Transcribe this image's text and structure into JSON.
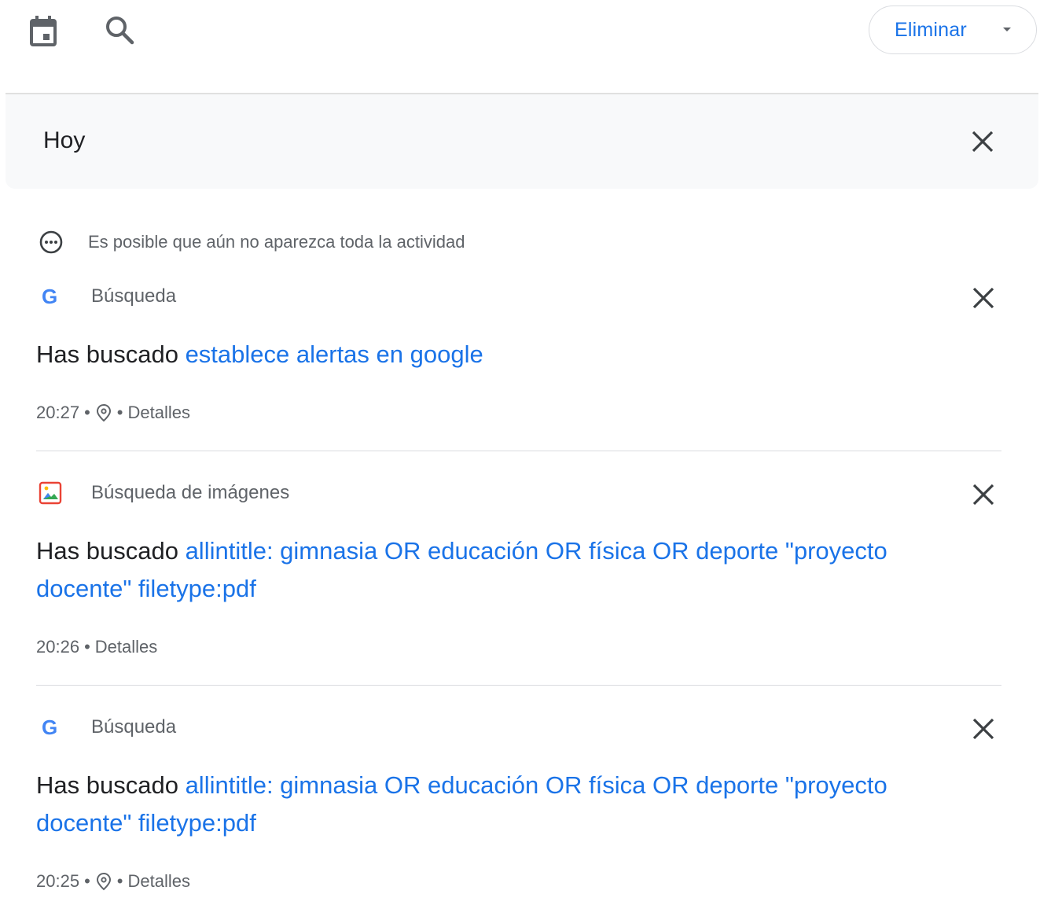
{
  "toolbar": {
    "calendar_icon": "calendar-icon",
    "search_icon": "search-icon",
    "delete_label": "Eliminar"
  },
  "day": {
    "title": "Hoy"
  },
  "notice": {
    "icon": "more-horiz-circle-icon",
    "text": "Es posible que aún no aparezca toda la actividad"
  },
  "entries": [
    {
      "product": "Búsqueda",
      "product_icon": "google-g-icon",
      "prefix": "Has buscado ",
      "query": "establece alertas en google",
      "time": "20:27",
      "has_location": true,
      "details": "Detalles"
    },
    {
      "product": "Búsqueda de imágenes",
      "product_icon": "image-search-icon",
      "prefix": "Has buscado ",
      "query": "allintitle: gimnasia OR educación OR física OR deporte \"proyecto docente\" filetype:pdf",
      "time": "20:26",
      "has_location": false,
      "details": "Detalles"
    },
    {
      "product": "Búsqueda",
      "product_icon": "google-g-icon",
      "prefix": "Has buscado ",
      "query": "allintitle: gimnasia OR educación OR física OR deporte \"proyecto docente\" filetype:pdf",
      "time": "20:25",
      "has_location": true,
      "details": "Detalles"
    }
  ],
  "colors": {
    "link": "#1a73e8",
    "text": "#202124",
    "secondary": "#5f6368",
    "header_bg": "#f8f9fa"
  }
}
